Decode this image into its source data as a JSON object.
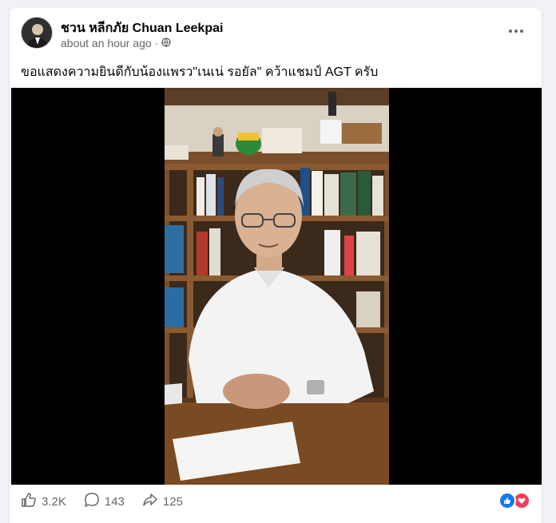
{
  "post": {
    "author": "ชวน หลีกภัย Chuan Leekpai",
    "time": "about an hour ago",
    "privacy_icon": "globe-icon",
    "text": "ขอแสดงความยินดีกับน้องแพรว\"เนเน่ รอยัล\" คว้าแชมป์ AGT ครับ"
  },
  "stats": {
    "likes": "3.2K",
    "comments": "143",
    "shares": "125"
  },
  "icons": {
    "like": "thumbs-up-icon",
    "comment": "comment-bubble-icon",
    "share": "share-arrow-icon",
    "reactions": [
      "like-reaction-icon",
      "love-reaction-icon"
    ]
  },
  "colors": {
    "like_blue": "#1877f2",
    "love_red": "#f33e58",
    "secondary_text": "#65676b"
  }
}
